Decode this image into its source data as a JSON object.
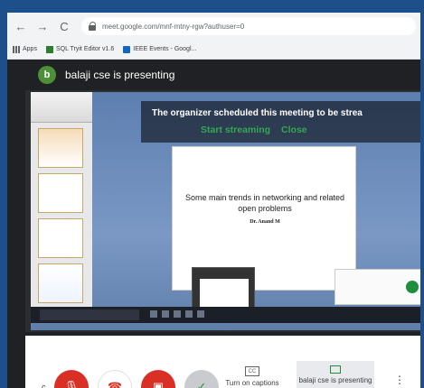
{
  "browser": {
    "url": "meet.google.com/mnf-mtny-rgw?authuser=0",
    "bookmarks": [
      "Apps",
      "SQL Tryit Editor v1.6",
      "IEEE Events - Googl..."
    ]
  },
  "meeting": {
    "presenter_initial": "b",
    "presenter_text": "balaji cse is presenting"
  },
  "organizer_notice": {
    "message": "The organizer scheduled this meeting to be strea",
    "start_label": "Start streaming",
    "close_label": "Close"
  },
  "slide": {
    "title": "Some main trends in networking and related open problems",
    "author": "Dr. Anand M"
  },
  "controls": {
    "left_letter": "c",
    "captions_icon": "CC",
    "captions_label": "Turn on captions",
    "presenting_label": "balaji cse is presenting"
  },
  "colors": {
    "danger": "#d93025",
    "accent": "#1e8e3e",
    "avatar": "#4e8f3a"
  }
}
